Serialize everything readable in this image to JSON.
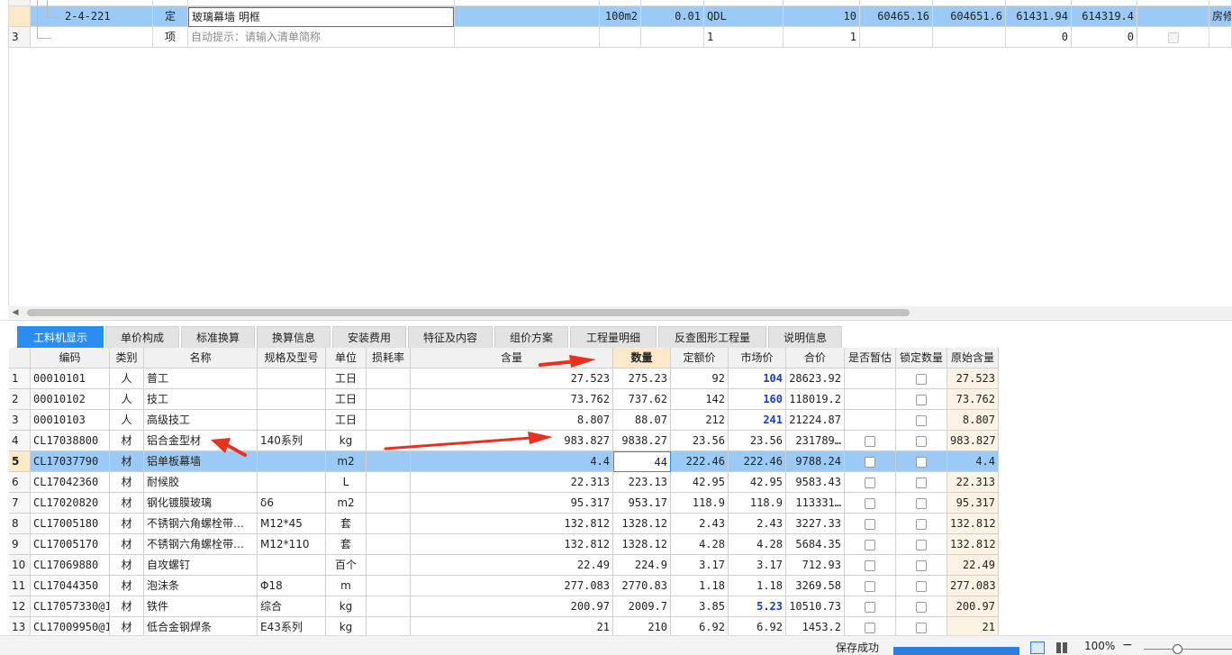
{
  "top_table": {
    "row_partial": {
      "num": "",
      "extra": ""
    },
    "row_selected": {
      "code": "2-4-221",
      "type": "定",
      "name": "玻璃幕墙 明框",
      "unit": "100m2",
      "qty_expr": "0.01",
      "qty_code": "QDL",
      "qty": "10",
      "unit_price": "60465.16",
      "total": "604651.6",
      "unit_price2": "61431.94",
      "total2": "614319.4",
      "extra": "房修"
    },
    "row_new": {
      "num": "3",
      "type": "项",
      "hint": "自动提示：请输入清单简称",
      "qty_code": "1",
      "qty": "1",
      "v1": "0",
      "v2": "0"
    }
  },
  "tabs": [
    "工料机显示",
    "单价构成",
    "标准换算",
    "换算信息",
    "安装费用",
    "特征及内容",
    "组价方案",
    "工程量明细",
    "反查图形工程量",
    "说明信息"
  ],
  "grid": {
    "headers": [
      "编码",
      "类别",
      "名称",
      "规格及型号",
      "单位",
      "损耗率",
      "含量",
      "数量",
      "定额价",
      "市场价",
      "合价",
      "是否暂估",
      "锁定数量",
      "原始含量"
    ],
    "rows": [
      {
        "i": "1",
        "code": "00010101",
        "cat": "人",
        "name": "普工",
        "spec": "",
        "unit": "工日",
        "loss": "",
        "content": "27.523",
        "qty": "275.23",
        "quota": "92",
        "market": "104",
        "total": "28623.92",
        "orig": "27.523"
      },
      {
        "i": "2",
        "code": "00010102",
        "cat": "人",
        "name": "技工",
        "spec": "",
        "unit": "工日",
        "loss": "",
        "content": "73.762",
        "qty": "737.62",
        "quota": "142",
        "market": "160",
        "total": "118019.2",
        "orig": "73.762"
      },
      {
        "i": "3",
        "code": "00010103",
        "cat": "人",
        "name": "高级技工",
        "spec": "",
        "unit": "工日",
        "loss": "",
        "content": "8.807",
        "qty": "88.07",
        "quota": "212",
        "market": "241",
        "total": "21224.87",
        "orig": "8.807"
      },
      {
        "i": "4",
        "code": "CL17038800",
        "cat": "材",
        "name": "铝合金型材",
        "spec": "140系列",
        "unit": "kg",
        "loss": "",
        "content": "983.827",
        "qty": "9838.27",
        "quota": "23.56",
        "market": "23.56",
        "total": "231789…",
        "orig": "983.827"
      },
      {
        "i": "5",
        "code": "CL17037790",
        "cat": "材",
        "name": "铝单板幕墙",
        "spec": "",
        "unit": "m2",
        "loss": "",
        "content": "4.4",
        "qty": "44",
        "quota": "222.46",
        "market": "222.46",
        "total": "9788.24",
        "orig": "4.4"
      },
      {
        "i": "6",
        "code": "CL17042360",
        "cat": "材",
        "name": "耐候胶",
        "spec": "",
        "unit": "L",
        "loss": "",
        "content": "22.313",
        "qty": "223.13",
        "quota": "42.95",
        "market": "42.95",
        "total": "9583.43",
        "orig": "22.313"
      },
      {
        "i": "7",
        "code": "CL17020820",
        "cat": "材",
        "name": "钢化镀膜玻璃",
        "spec": "δ6",
        "unit": "m2",
        "loss": "",
        "content": "95.317",
        "qty": "953.17",
        "quota": "118.9",
        "market": "118.9",
        "total": "113331…",
        "orig": "95.317"
      },
      {
        "i": "8",
        "code": "CL17005180",
        "cat": "材",
        "name": "不锈钢六角螺栓带…",
        "spec": "M12*45",
        "unit": "套",
        "loss": "",
        "content": "132.812",
        "qty": "1328.12",
        "quota": "2.43",
        "market": "2.43",
        "total": "3227.33",
        "orig": "132.812"
      },
      {
        "i": "9",
        "code": "CL17005170",
        "cat": "材",
        "name": "不锈钢六角螺栓带…",
        "spec": "M12*110",
        "unit": "套",
        "loss": "",
        "content": "132.812",
        "qty": "1328.12",
        "quota": "4.28",
        "market": "4.28",
        "total": "5684.35",
        "orig": "132.812"
      },
      {
        "i": "10",
        "code": "CL17069880",
        "cat": "材",
        "name": "自攻螺钉",
        "spec": "",
        "unit": "百个",
        "loss": "",
        "content": "22.49",
        "qty": "224.9",
        "quota": "3.17",
        "market": "3.17",
        "total": "712.93",
        "orig": "22.49"
      },
      {
        "i": "11",
        "code": "CL17044350",
        "cat": "材",
        "name": "泡沫条",
        "spec": "Φ18",
        "unit": "m",
        "loss": "",
        "content": "277.083",
        "qty": "2770.83",
        "quota": "1.18",
        "market": "1.18",
        "total": "3269.58",
        "orig": "277.083"
      },
      {
        "i": "12",
        "code": "CL17057330@1",
        "cat": "材",
        "name": "铁件",
        "spec": "综合",
        "unit": "kg",
        "loss": "",
        "content": "200.97",
        "qty": "2009.7",
        "quota": "3.85",
        "market": "5.23",
        "total": "10510.73",
        "orig": "200.97"
      },
      {
        "i": "13",
        "code": "CL17009950@1",
        "cat": "材",
        "name": "低合金钢焊条",
        "spec": "E43系列",
        "unit": "kg",
        "loss": "",
        "content": "21",
        "qty": "210",
        "quota": "6.92",
        "market": "6.92",
        "total": "1453.2",
        "orig": "21"
      }
    ],
    "market_highlight_rows": [
      0,
      1,
      2,
      11
    ]
  },
  "status": {
    "message": "保存成功",
    "zoom": "100%"
  },
  "colors": {
    "accent": "#2b8df0",
    "selected_row": "#9ccaf7",
    "arrow_red": "#e8321f",
    "market_blue": "#1a3dcc"
  }
}
